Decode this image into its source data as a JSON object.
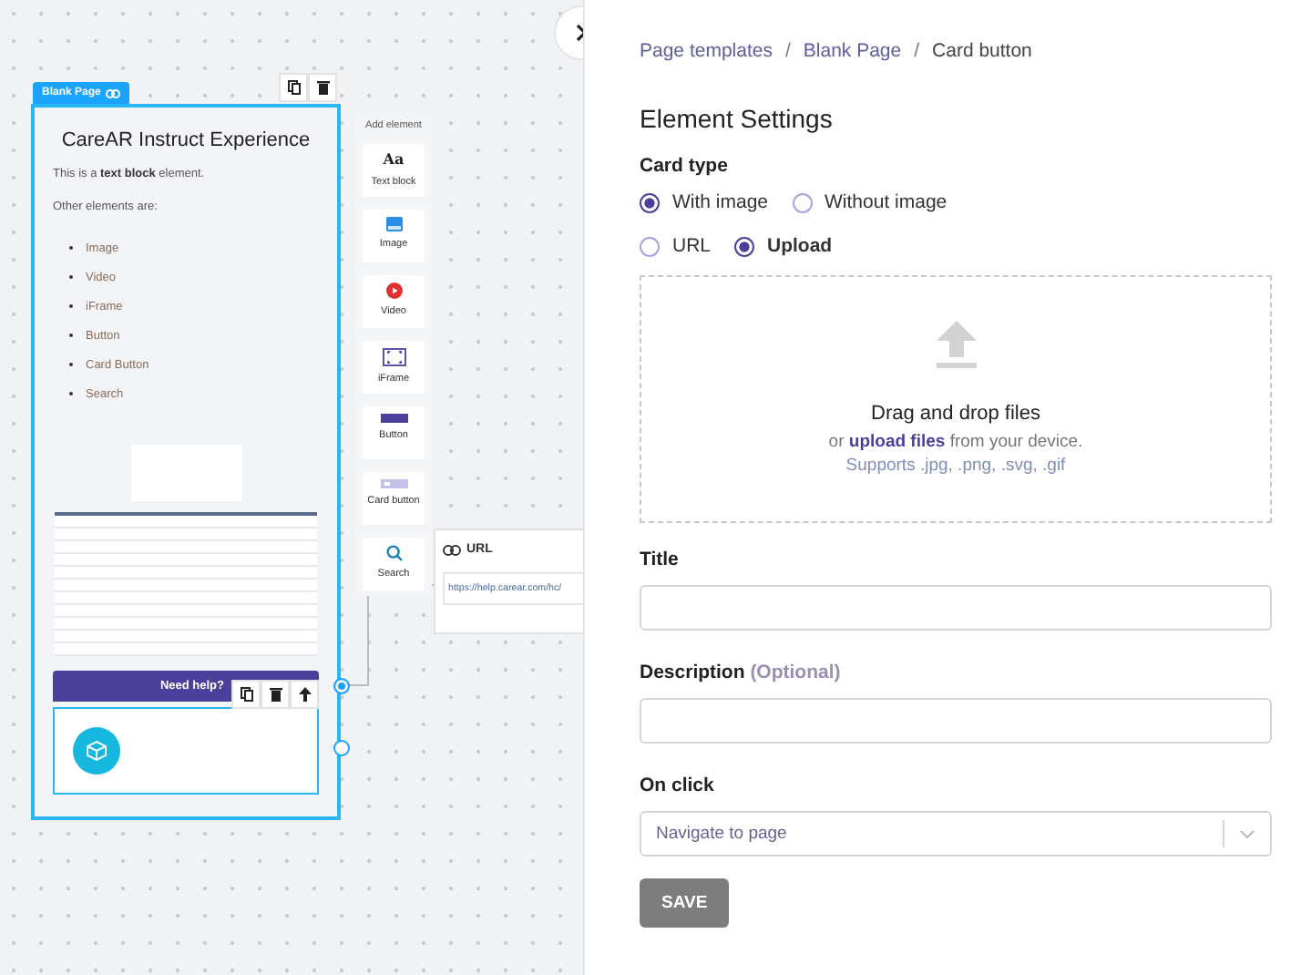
{
  "canvas": {
    "page": {
      "tab_label": "Blank Page",
      "title": "CareAR Instruct Experience",
      "intro": "This is a **text block** element.",
      "list_heading": "Other elements are:",
      "list_items": [
        "Image",
        "Video",
        "iFrame",
        "Button",
        "Card Button",
        "Search"
      ],
      "card_button": {
        "label": "Need help?"
      }
    },
    "palette": {
      "title": "Add element",
      "items": [
        {
          "kind": "text",
          "label": "Text block",
          "glyph": "Aa"
        },
        {
          "kind": "image",
          "label": "Image"
        },
        {
          "kind": "video",
          "label": "Video"
        },
        {
          "kind": "iframe",
          "label": "iFrame"
        },
        {
          "kind": "button",
          "label": "Button"
        },
        {
          "kind": "card",
          "label": "Card button"
        },
        {
          "kind": "search",
          "label": "Search"
        }
      ]
    },
    "url_node": {
      "label": "URL",
      "value": "https://help.carear.com/hc/"
    }
  },
  "breadcrumb": {
    "separator": "/",
    "items": [
      "Page templates",
      "Blank Page",
      "Card button"
    ]
  },
  "settings": {
    "heading": "Element Settings",
    "card_type": {
      "label": "Card type",
      "options": [
        {
          "label": "With image",
          "selected": true
        },
        {
          "label": "Without image",
          "selected": false
        }
      ]
    },
    "source": {
      "options": [
        {
          "label": "URL",
          "selected": false
        },
        {
          "label": "Upload",
          "selected": true
        }
      ]
    },
    "dropzone": {
      "title": "Drag and drop files",
      "line": "or **upload files** from your device.",
      "formats": "Supports .jpg, .png, .svg, .gif"
    },
    "fields": [
      {
        "label": "Title"
      },
      {
        "label": "Description",
        "hint": "(Optional)"
      }
    ],
    "on_click": {
      "label": "On click",
      "value": "Navigate to page"
    },
    "save": {
      "label": "SAVE",
      "disabled": true
    }
  }
}
